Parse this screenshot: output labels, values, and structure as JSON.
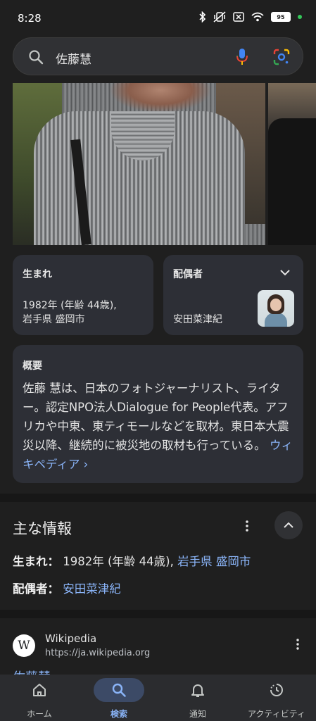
{
  "status_bar": {
    "time": "8:28",
    "battery": "95",
    "icons": [
      "bluetooth-icon",
      "vibrate-off-icon",
      "nfc-icon",
      "wifi-icon",
      "battery-icon",
      "privacy-dot-icon"
    ]
  },
  "search": {
    "query": "佐藤慧",
    "icons": [
      "search-icon",
      "mic-icon",
      "lens-icon"
    ]
  },
  "knowledge_panel": {
    "born": {
      "label": "生まれ",
      "value": "1982年 (年齢 44歳),\n岩手県 盛岡市"
    },
    "spouse": {
      "label": "配偶者",
      "value": "安田菜津紀"
    },
    "overview": {
      "label": "概要",
      "text": "佐藤 慧は、日本のフォトジャーナリスト、ライター。認定NPO法人Dialogue for People代表。アフリカや中東、東ティモールなどを取材。東日本大震災以降、継続的に被災地の取材も行っている。",
      "link_label": "ウィキペディア ›"
    }
  },
  "main_info": {
    "title": "主な情報",
    "born_key": "生まれ：",
    "born_plain": "1982年 (年齢 44歳), ",
    "born_place": "岩手県 盛岡市",
    "spouse_key": "配偶者：",
    "spouse_value": "安田菜津紀"
  },
  "wiki_result": {
    "favicon_letter": "W",
    "site": "Wikipedia",
    "url": "https://ja.wikipedia.org",
    "peek_title": "佐藤慧"
  },
  "bottom_nav": {
    "items": [
      {
        "label": "ホーム",
        "icon": "home-icon"
      },
      {
        "label": "検索",
        "icon": "search-icon"
      },
      {
        "label": "通知",
        "icon": "bell-icon"
      },
      {
        "label": "アクティビティ",
        "icon": "activity-icon"
      }
    ],
    "active_index": 1
  },
  "colors": {
    "background": "#1f1f1f",
    "card": "#2d2f36",
    "link": "#8ab4f8",
    "nav_active_pill": "#3c4a66"
  }
}
